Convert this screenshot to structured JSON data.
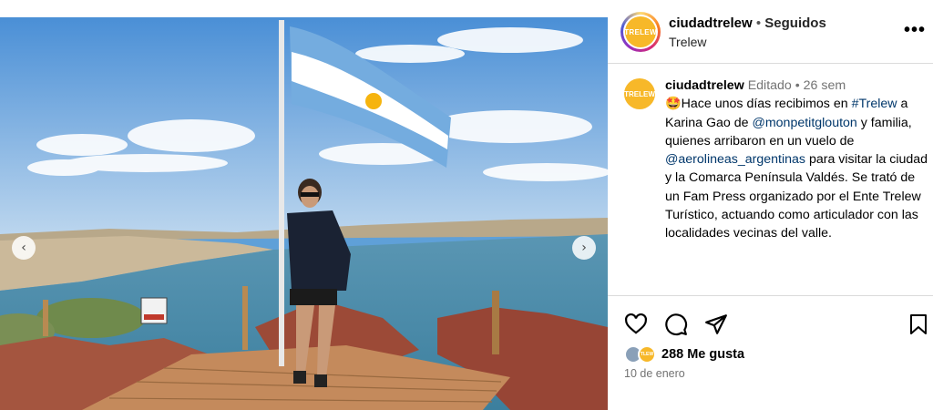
{
  "post": {
    "image_alt": "Mujer posando junto a la bandera argentina frente al mar en Península Valdés",
    "nav_prev_icon": "chevron-left-icon",
    "nav_next_icon": "chevron-right-icon"
  },
  "header": {
    "username": "ciudadtrelew",
    "separator": " • ",
    "follow_status": "Seguidos",
    "location": "Trelew",
    "more_label": "•••",
    "avatar_text": "TRELEW"
  },
  "caption": {
    "username": "ciudadtrelew",
    "edited": "Editado",
    "dot": " • ",
    "time_ago": "26 sem",
    "emoji": "🤩",
    "text_1": "Hace unos días recibimos en ",
    "hashtag": "#Trelew",
    "text_2": " a Karina Gao de ",
    "mention_1": "@monpetitglouton",
    "text_3": " y familia, quienes arribaron en un vuelo de ",
    "mention_2": "@aerolineas_argentinas",
    "text_4": " para visitar la ciudad y la Comarca Península Valdés. Se trató de un Fam Press organizado por el Ente Trelew Turístico, actuando como articulador con las localidades vecinas del valle.",
    "avatar_text": "TRELEW"
  },
  "actions": {
    "like_icon": "heart-icon",
    "comment_icon": "comment-icon",
    "share_icon": "share-icon",
    "save_icon": "bookmark-icon",
    "likes_text": "288 Me gusta",
    "date": "10 de enero",
    "mini_avatar_text": "TLEW"
  },
  "colors": {
    "link": "#00376b",
    "meta": "#737373",
    "brand_yellow": "#f7b829"
  }
}
